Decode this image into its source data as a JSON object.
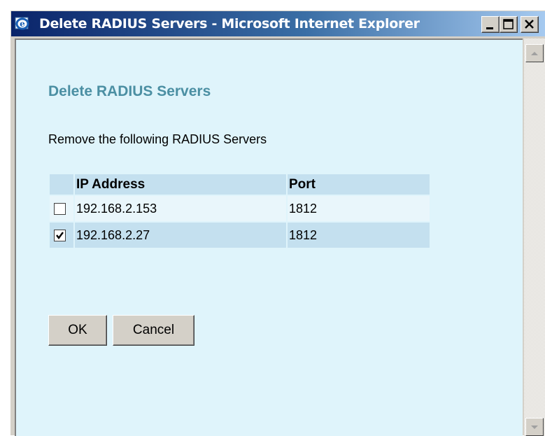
{
  "window": {
    "title": "Delete RADIUS Servers - Microsoft Internet Explorer"
  },
  "page": {
    "heading": "Delete RADIUS Servers",
    "instruction": "Remove the following RADIUS Servers"
  },
  "table": {
    "headers": {
      "ip": "IP Address",
      "port": "Port"
    },
    "rows": [
      {
        "ip": "192.168.2.153",
        "port": "1812",
        "checked": false
      },
      {
        "ip": "192.168.2.27",
        "port": "1812",
        "checked": true
      }
    ]
  },
  "buttons": {
    "ok": "OK",
    "cancel": "Cancel"
  },
  "colors": {
    "heading": "#4b8fa3",
    "page_background": "#dff4fb",
    "row_alt": "#c4e0ef"
  },
  "icons": {
    "title": "ie-logo-icon",
    "minimize": "minimize-icon",
    "maximize": "maximize-icon",
    "close": "close-icon",
    "checkmark": "checkmark-icon",
    "scroll_up": "scroll-up-arrow-icon",
    "scroll_down": "scroll-down-arrow-icon"
  }
}
